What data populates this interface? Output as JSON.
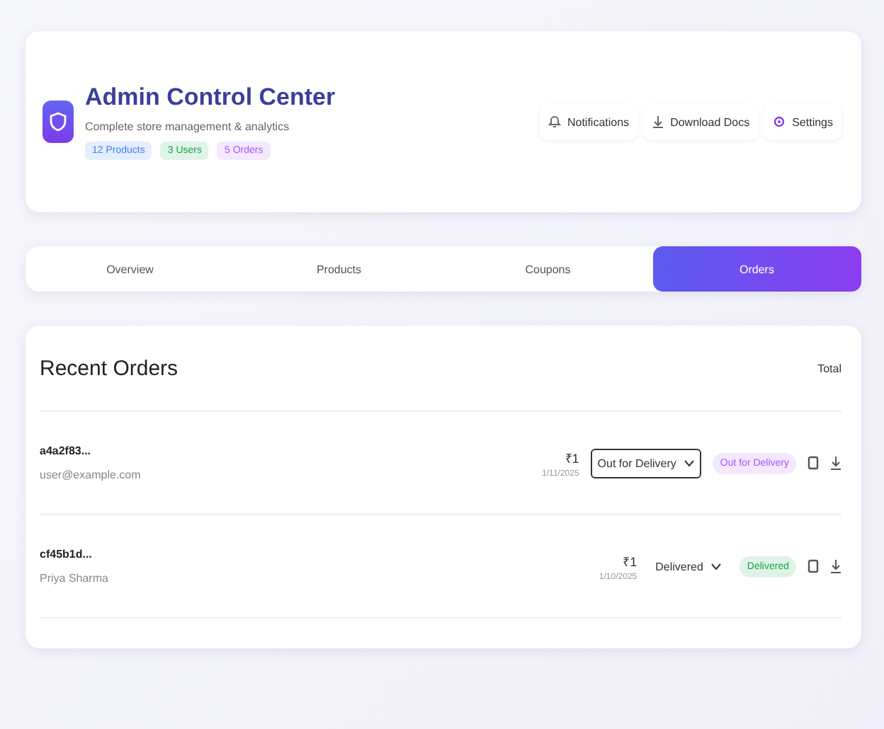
{
  "header": {
    "title": "Admin Control Center",
    "subtitle": "Complete store management & analytics",
    "badges": [
      {
        "label": "12 Products",
        "color": "#3b82f6"
      },
      {
        "label": "3 Users",
        "color": "#16a34a"
      },
      {
        "label": "5 Orders",
        "color": "#a855f7"
      }
    ],
    "actions": [
      {
        "label": "Notifications",
        "kind": "notify"
      },
      {
        "label": "Download Docs",
        "kind": "download"
      },
      {
        "label": "Settings",
        "kind": "settings"
      }
    ]
  },
  "tabs": [
    {
      "label": "Overview",
      "selected": false
    },
    {
      "label": "Products",
      "selected": false
    },
    {
      "label": "Coupons",
      "selected": false
    },
    {
      "label": "Orders",
      "selected": true
    }
  ],
  "orders": {
    "title": "Recent Orders",
    "count": "Total",
    "rows": [
      {
        "id": "a4a2f83...",
        "customer": "user@example.com",
        "amount": "₹1",
        "date": "1/11/2025",
        "status": "Out for Delivery",
        "select_focused": true,
        "badge": {
          "label": "Out for Delivery",
          "color": "#a855f7"
        }
      },
      {
        "id": "cf45b1d...",
        "customer": "Priya Sharma",
        "amount": "₹1",
        "date": "1/10/2025",
        "status": "Delivered",
        "select_focused": false,
        "badge": {
          "label": "Delivered",
          "color": "#16a34a"
        }
      }
    ]
  }
}
